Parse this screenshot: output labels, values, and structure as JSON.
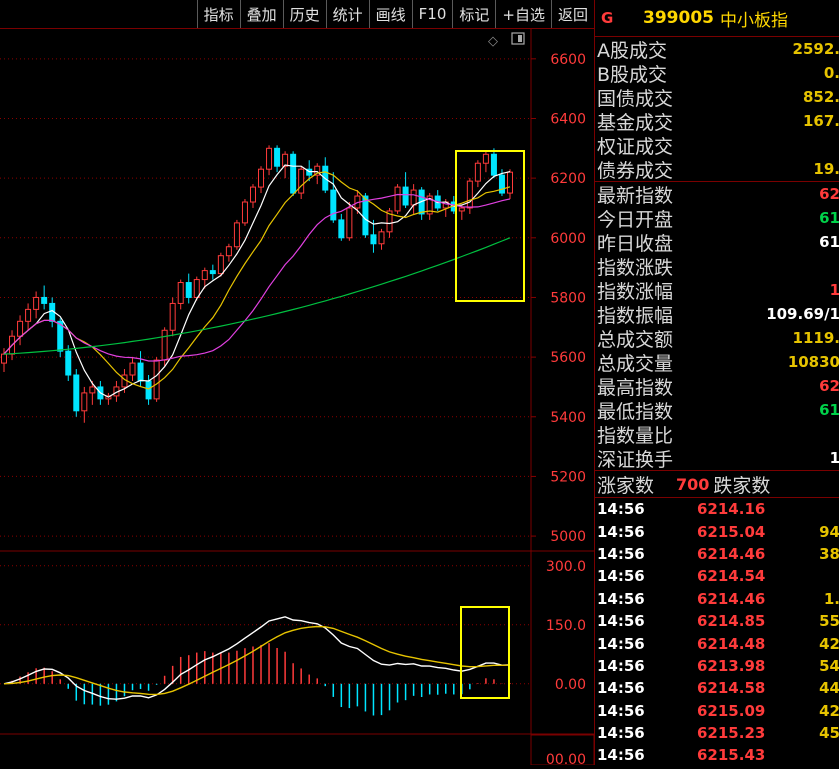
{
  "toolbar": {
    "items": [
      "指标",
      "叠加",
      "历史",
      "统计",
      "画线",
      "F10",
      "标记",
      "+自选",
      "返回"
    ]
  },
  "chart": {
    "price_ticks": [
      "6600",
      "6400",
      "6200",
      "6000",
      "5800",
      "5600",
      "5400",
      "5200",
      "5000"
    ],
    "macd_ticks": [
      "300.0",
      "150.0",
      "0.00"
    ],
    "bottom_tick": "00.00",
    "colors": {
      "up": "#ff3b3b",
      "down": "#00e5ff",
      "ma5": "#ffffff",
      "ma10": "#e6c300",
      "ma20": "#e040e0",
      "ma60": "#00c040",
      "box": "#ffff00"
    }
  },
  "chart_data": {
    "type": "candlestick",
    "ylim": [
      4950,
      6700
    ],
    "macd_ylim": [
      -120,
      330
    ],
    "candles": [
      [
        5580,
        5630,
        5550,
        5610
      ],
      [
        5610,
        5690,
        5590,
        5670
      ],
      [
        5670,
        5740,
        5640,
        5720
      ],
      [
        5720,
        5780,
        5690,
        5760
      ],
      [
        5760,
        5820,
        5730,
        5800
      ],
      [
        5800,
        5840,
        5760,
        5780
      ],
      [
        5780,
        5800,
        5700,
        5720
      ],
      [
        5720,
        5730,
        5600,
        5620
      ],
      [
        5620,
        5640,
        5520,
        5540
      ],
      [
        5540,
        5560,
        5400,
        5420
      ],
      [
        5420,
        5500,
        5380,
        5480
      ],
      [
        5480,
        5520,
        5440,
        5500
      ],
      [
        5500,
        5520,
        5440,
        5460
      ],
      [
        5460,
        5480,
        5440,
        5470
      ],
      [
        5470,
        5520,
        5450,
        5500
      ],
      [
        5500,
        5560,
        5480,
        5540
      ],
      [
        5540,
        5600,
        5520,
        5580
      ],
      [
        5580,
        5620,
        5500,
        5520
      ],
      [
        5520,
        5540,
        5440,
        5460
      ],
      [
        5460,
        5600,
        5450,
        5590
      ],
      [
        5590,
        5700,
        5570,
        5690
      ],
      [
        5690,
        5800,
        5670,
        5780
      ],
      [
        5780,
        5860,
        5760,
        5850
      ],
      [
        5850,
        5880,
        5780,
        5800
      ],
      [
        5800,
        5870,
        5790,
        5860
      ],
      [
        5860,
        5900,
        5830,
        5890
      ],
      [
        5890,
        5910,
        5860,
        5880
      ],
      [
        5880,
        5950,
        5870,
        5940
      ],
      [
        5940,
        5980,
        5920,
        5970
      ],
      [
        5970,
        6060,
        5960,
        6050
      ],
      [
        6050,
        6130,
        6040,
        6120
      ],
      [
        6120,
        6180,
        6100,
        6170
      ],
      [
        6170,
        6240,
        6150,
        6230
      ],
      [
        6230,
        6310,
        6210,
        6300
      ],
      [
        6300,
        6310,
        6220,
        6240
      ],
      [
        6240,
        6290,
        6200,
        6280
      ],
      [
        6280,
        6290,
        6140,
        6150
      ],
      [
        6150,
        6240,
        6130,
        6230
      ],
      [
        6230,
        6260,
        6190,
        6210
      ],
      [
        6210,
        6250,
        6180,
        6240
      ],
      [
        6240,
        6270,
        6150,
        6160
      ],
      [
        6160,
        6220,
        6050,
        6060
      ],
      [
        6060,
        6080,
        5990,
        6000
      ],
      [
        6000,
        6120,
        5990,
        6100
      ],
      [
        6100,
        6160,
        6080,
        6140
      ],
      [
        6140,
        6150,
        6000,
        6010
      ],
      [
        6010,
        6060,
        5950,
        5980
      ],
      [
        5980,
        6030,
        5960,
        6020
      ],
      [
        6020,
        6100,
        6000,
        6090
      ],
      [
        6090,
        6180,
        6080,
        6170
      ],
      [
        6170,
        6220,
        6100,
        6110
      ],
      [
        6110,
        6180,
        6080,
        6160
      ],
      [
        6160,
        6170,
        6060,
        6080
      ],
      [
        6080,
        6150,
        6060,
        6140
      ],
      [
        6140,
        6160,
        6090,
        6100
      ],
      [
        6100,
        6130,
        6070,
        6120
      ],
      [
        6120,
        6140,
        6080,
        6090
      ],
      [
        6090,
        6110,
        6060,
        6100
      ],
      [
        6100,
        6200,
        6080,
        6190
      ],
      [
        6190,
        6260,
        6170,
        6250
      ],
      [
        6250,
        6290,
        6220,
        6280
      ],
      [
        6280,
        6300,
        6200,
        6210
      ],
      [
        6210,
        6230,
        6140,
        6150
      ],
      [
        6150,
        6230,
        6130,
        6220
      ]
    ],
    "ma60_start": 5610,
    "ma60_end": 6000
  },
  "panel": {
    "g_mark": "G",
    "code": "399005",
    "name": "中小板指",
    "rows_a": [
      {
        "label": "A股成交",
        "value": "2592.",
        "cls": "y"
      },
      {
        "label": "B股成交",
        "value": "0.",
        "cls": "y"
      },
      {
        "label": "国债成交",
        "value": "852.",
        "cls": "y"
      },
      {
        "label": "基金成交",
        "value": "167.",
        "cls": "y"
      },
      {
        "label": "权证成交",
        "value": "",
        "cls": "y"
      },
      {
        "label": "债券成交",
        "value": "19.",
        "cls": "y"
      }
    ],
    "rows_b": [
      {
        "label": "最新指数",
        "value": "62",
        "cls": "r"
      },
      {
        "label": "今日开盘",
        "value": "61",
        "cls": "gr"
      },
      {
        "label": "昨日收盘",
        "value": "61",
        "cls": "w"
      },
      {
        "label": "指数涨跌",
        "value": "",
        "cls": "r"
      },
      {
        "label": "指数涨幅",
        "value": "1",
        "cls": "r"
      },
      {
        "label": "指数振幅",
        "value": "109.69/1",
        "cls": "w"
      },
      {
        "label": "总成交额",
        "value": "1119.",
        "cls": "y"
      },
      {
        "label": "总成交量",
        "value": "10830",
        "cls": "y"
      },
      {
        "label": "最高指数",
        "value": "62",
        "cls": "r"
      },
      {
        "label": "最低指数",
        "value": "61",
        "cls": "gr"
      },
      {
        "label": "指数量比",
        "value": "",
        "cls": "y"
      },
      {
        "label": "深证换手",
        "value": "1",
        "cls": "w"
      }
    ],
    "zhang_label": "涨家数",
    "zhang_count": "700",
    "die_label": "跌家数",
    "ticks": [
      {
        "time": "14:56",
        "price": "6214.16",
        "vol": ""
      },
      {
        "time": "14:56",
        "price": "6215.04",
        "vol": "94"
      },
      {
        "time": "14:56",
        "price": "6214.46",
        "vol": "38"
      },
      {
        "time": "14:56",
        "price": "6214.54",
        "vol": ""
      },
      {
        "time": "14:56",
        "price": "6214.46",
        "vol": "1."
      },
      {
        "time": "14:56",
        "price": "6214.85",
        "vol": "55"
      },
      {
        "time": "14:56",
        "price": "6214.48",
        "vol": "42"
      },
      {
        "time": "14:56",
        "price": "6213.98",
        "vol": "54"
      },
      {
        "time": "14:56",
        "price": "6214.58",
        "vol": "44"
      },
      {
        "time": "14:56",
        "price": "6215.09",
        "vol": "42"
      },
      {
        "time": "14:56",
        "price": "6215.23",
        "vol": "45"
      },
      {
        "time": "14:56",
        "price": "6215.43",
        "vol": ""
      }
    ]
  }
}
